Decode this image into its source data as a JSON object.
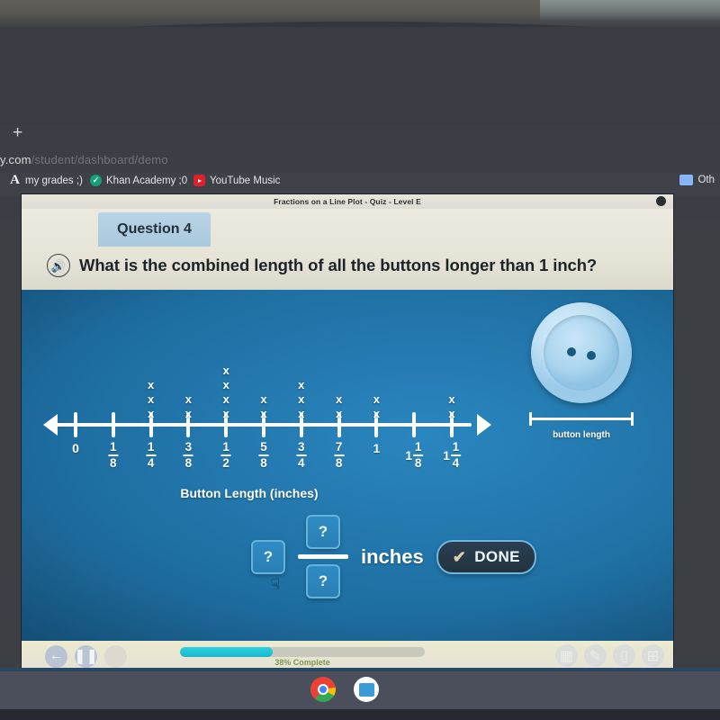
{
  "browser": {
    "new_tab_label": "+",
    "url_visible": "y.com",
    "url_dim": "/student/dashboard/demo",
    "bookmarks": [
      {
        "label": "my grades ;)",
        "icon": "letter-a-icon"
      },
      {
        "label": "Khan Academy ;0",
        "icon": "khan-academy-icon"
      },
      {
        "label": "YouTube Music",
        "icon": "youtube-music-icon"
      }
    ],
    "other_bookmarks": "Oth",
    "other_bookmarks_icon": "folder-icon"
  },
  "app": {
    "title": "Fractions on a Line Plot - Quiz - Level E",
    "question_tag": "Question 4",
    "question_text": "What is the combined length of all the buttons longer than 1 inch?",
    "speaker_icon": "speaker-icon",
    "axis_title": "Button Length (inches)",
    "button_image_label": "button length",
    "answer": {
      "whole_placeholder": "?",
      "numerator_placeholder": "?",
      "denominator_placeholder": "?",
      "unit": "inches",
      "done_label": "DONE",
      "done_check_icon": "check-icon"
    },
    "toolbar": {
      "back_icon": "back-arrow-icon",
      "pause_icon": "pause-icon",
      "blank_icon": "blank-icon",
      "progress_percent": 38,
      "progress_label": "38% Complete",
      "right_icons": [
        "glossary-icon",
        "pencil-icon",
        "notepad-icon",
        "calculator-icon"
      ]
    }
  },
  "chart_data": {
    "type": "line-plot",
    "title": "",
    "xlabel": "Button Length (inches)",
    "ylabel": "",
    "grid": false,
    "legend": "none",
    "marker": "x",
    "categories": [
      "0",
      "1/8",
      "1/4",
      "3/8",
      "1/2",
      "5/8",
      "3/4",
      "7/8",
      "1",
      "1 1/8",
      "1 1/4"
    ],
    "tick_labels": [
      {
        "whole": "0",
        "num": "",
        "den": ""
      },
      {
        "whole": "",
        "num": "1",
        "den": "8"
      },
      {
        "whole": "",
        "num": "1",
        "den": "4"
      },
      {
        "whole": "",
        "num": "3",
        "den": "8"
      },
      {
        "whole": "",
        "num": "1",
        "den": "2"
      },
      {
        "whole": "",
        "num": "5",
        "den": "8"
      },
      {
        "whole": "",
        "num": "3",
        "den": "4"
      },
      {
        "whole": "",
        "num": "7",
        "den": "8"
      },
      {
        "whole": "1",
        "num": "",
        "den": ""
      },
      {
        "whole": "1",
        "num": "1",
        "den": "8"
      },
      {
        "whole": "1",
        "num": "1",
        "den": "4"
      }
    ],
    "values": [
      0,
      0,
      3,
      2,
      4,
      2,
      3,
      2,
      2,
      0,
      2
    ],
    "xlim": [
      0,
      1.25
    ],
    "ylim": [
      0,
      4
    ]
  },
  "shelf": {
    "icons": [
      "chrome-icon",
      "app-icon"
    ]
  }
}
